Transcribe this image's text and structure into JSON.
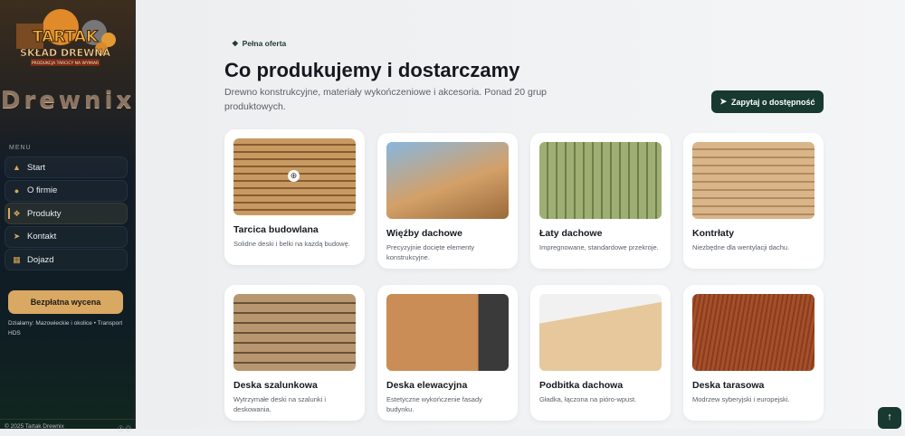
{
  "sidebar": {
    "logo_text": "TARTAK SKŁAD DREWNA",
    "logo_tagline": "PRODUKCJA TARCICY NA WYMIAR",
    "brand": "Drewnix",
    "menu_label": "MENU",
    "items": [
      {
        "label": "Start",
        "icon": "tree-icon"
      },
      {
        "label": "O firmie",
        "icon": "info-icon"
      },
      {
        "label": "Produkty",
        "icon": "cubes-icon",
        "active": true
      },
      {
        "label": "Kontakt",
        "icon": "paper-plane-icon"
      },
      {
        "label": "Dojazd",
        "icon": "map-icon"
      }
    ],
    "cta": "Bezpłatna wycena",
    "area": "Działamy: Mazowieckie i okolice • Transport HDS",
    "copyright": "© 2025 Tartak Drewnix"
  },
  "header": {
    "badge": "Pełna oferta",
    "title": "Co produkujemy i dostarczamy",
    "subtitle": "Drewno konstrukcyjne, materiały wykończeniowe i akcesoria. Ponad 20 grup produktowych.",
    "ask_button": "Zapytaj o dostępność"
  },
  "products": [
    {
      "title": "Tarcica budowlana",
      "desc": "Solidne deski i belki na każdą budowę."
    },
    {
      "title": "Więźby dachowe",
      "desc": "Precyzyjnie docięte elementy konstrukcyjne."
    },
    {
      "title": "Łaty dachowe",
      "desc": "Impregnowane, standardowe przekroje."
    },
    {
      "title": "Kontrłaty",
      "desc": "Niezbędne dla wentylacji dachu."
    },
    {
      "title": "Deska szalunkowa",
      "desc": "Wytrzymałe deski na szalunki i deskowania."
    },
    {
      "title": "Deska elewacyjna",
      "desc": "Estetyczne wykończenie fasady budynku."
    },
    {
      "title": "Podbitka dachowa",
      "desc": "Gładka, łączona na pióro-wpust."
    },
    {
      "title": "Deska tarasowa",
      "desc": "Modrzew syberyjski i europejski."
    }
  ],
  "colors": {
    "accent": "#d9a863",
    "dark_green": "#17392f"
  }
}
